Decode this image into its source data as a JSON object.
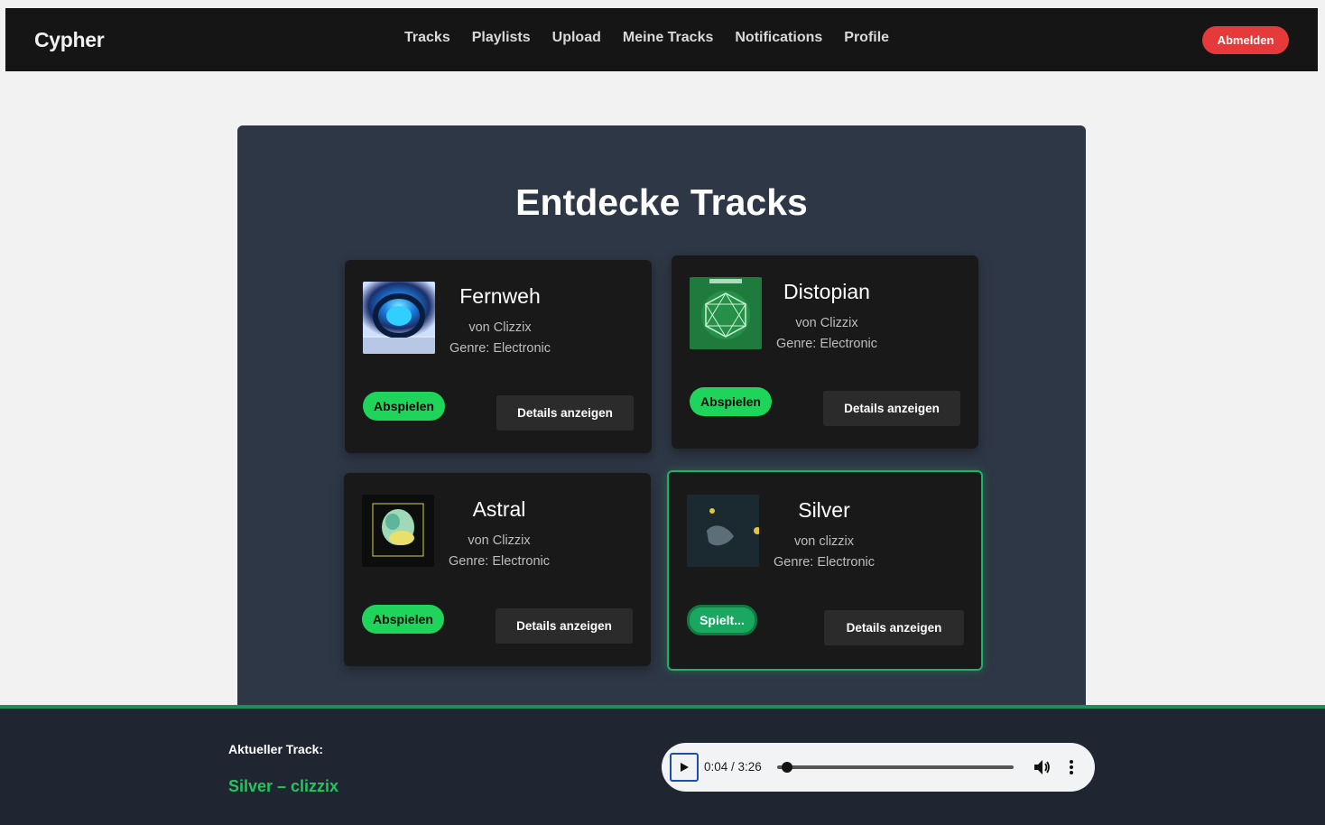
{
  "nav": {
    "brand": "Cypher",
    "links": [
      "Tracks",
      "Playlists",
      "Upload",
      "Meine Tracks",
      "Notifications",
      "Profile"
    ],
    "logout_label": "Abmelden"
  },
  "main": {
    "title": "Entdecke Tracks",
    "tracks": [
      {
        "title": "Fernweh",
        "artist": "von Clizzix",
        "genre": "Genre: Electronic",
        "play_label": "Abspielen",
        "details_label": "Details anzeigen"
      },
      {
        "title": "Distopian",
        "artist": "von Clizzix",
        "genre": "Genre: Electronic",
        "play_label": "Abspielen",
        "details_label": "Details anzeigen"
      },
      {
        "title": "Astral",
        "artist": "von Clizzix",
        "genre": "Genre: Electronic",
        "play_label": "Abspielen",
        "details_label": "Details anzeigen"
      },
      {
        "title": "Silver",
        "artist": "von clizzix",
        "genre": "Genre: Electronic",
        "play_label": "Spielt...",
        "details_label": "Details anzeigen"
      }
    ]
  },
  "player": {
    "current_label": "Aktueller Track:",
    "current_track": "Silver – clizzix",
    "time": "0:04 / 3:26",
    "progress": 0.02
  },
  "colors": {
    "accent_green": "#1ed45a",
    "logout_red": "#e63a3a",
    "panel": "#2e3746"
  }
}
